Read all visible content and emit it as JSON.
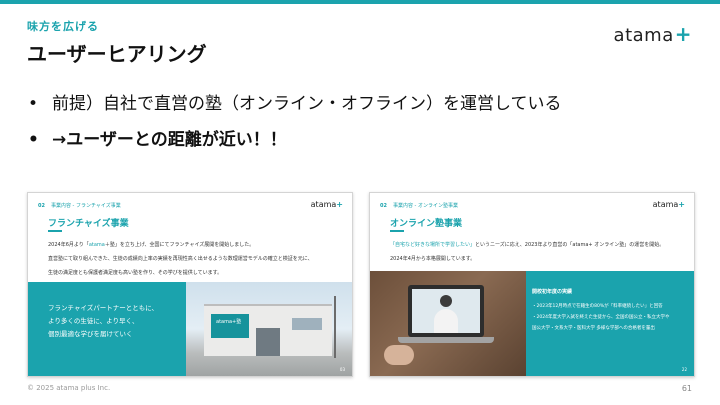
{
  "header": {
    "section_label": "味方を広げる",
    "title": "ユーザーヒアリング",
    "brand_text": "atama",
    "brand_plus": "+"
  },
  "bullets": [
    {
      "marker": "•",
      "text": "前提）自社で直営の塾（オンライン・オフライン）を運営している"
    },
    {
      "marker": "•",
      "text": "→ユーザーとの距離が近い！！"
    }
  ],
  "slides": [
    {
      "number": "02",
      "category": "事業内容 - フランチャイズ事業",
      "brand_text": "atama",
      "brand_plus": "+",
      "title": "フランチャイズ事業",
      "body": [
        {
          "before": "2024年6月より「",
          "highlight": "atama",
          "after": "＋塾」を立ち上げ、全国にてフランチャイズ展開を開始しました。"
        },
        {
          "before": "直営塾にて取り組んできた、生徒の成績向上率の実績を再現性高く出せるような数理運営モデルの確立と検証を元に、",
          "highlight": "",
          "after": ""
        },
        {
          "before": "生徒の満足度とも保護者満足度も高い塾を作り、その学びを提供しています。",
          "highlight": "",
          "after": ""
        }
      ],
      "box_lines": [
        "フランチャイズパートナーとともに、",
        "より多くの生徒に、より早く、",
        "個別最適な学びを届けていく"
      ],
      "sign_text": "atama+塾",
      "page_no": "03"
    },
    {
      "number": "02",
      "category": "事業内容 - オンライン塾事業",
      "brand_text": "atama",
      "brand_plus": "+",
      "title": "オンライン塾事業",
      "body": [
        {
          "before": "",
          "highlight": "「自宅など好きな場所で学習したい」",
          "after": "というニーズに応え、2023年より直営の「atama+ オンライン塾」の運営を開始。"
        },
        {
          "before": "2024年4月から本格展開しています。",
          "highlight": "",
          "after": ""
        }
      ],
      "box_title": "開校初年度の実績",
      "box_items": [
        "・2023年12月時点で在籍生の80%が「料率継続したい」と回答",
        "・2024年度大学入試を終えた生徒から、全国の国公立・私立大学や",
        "  国公大学・文系大学・医科大学 多様な学部への合格者を輩出"
      ],
      "page_no": "22"
    }
  ],
  "footer": {
    "copyright": "© 2025 atama plus Inc.",
    "page_number": "61"
  }
}
